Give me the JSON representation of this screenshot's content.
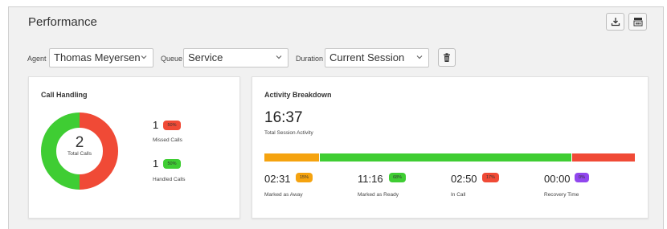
{
  "header": {
    "title": "Performance",
    "download_icon": "download-icon",
    "layout_icon": "layout-icon"
  },
  "filters": {
    "agent_label": "Agent",
    "agent_value": "Thomas Meyersen",
    "queue_label": "Queue",
    "queue_value": "Service",
    "duration_label": "Duration",
    "duration_value": "Current Session",
    "clear_icon": "trash-icon"
  },
  "call_handling": {
    "title": "Call Handling",
    "total": "2",
    "total_label": "Total Calls",
    "missed": {
      "count": "1",
      "percent": "50%",
      "label": "Missed Calls"
    },
    "handled": {
      "count": "1",
      "percent": "50%",
      "label": "Handled Calls"
    },
    "chart_data": {
      "type": "pie",
      "categories": [
        "Missed Calls",
        "Handled Calls"
      ],
      "values": [
        1,
        1
      ],
      "colors": [
        "#f04a36",
        "#3fcd33"
      ]
    }
  },
  "activity": {
    "title": "Activity Breakdown",
    "total_time": "16:37",
    "total_label": "Total Session Activity",
    "items": [
      {
        "time": "02:31",
        "percent": "15%",
        "label": "Marked as Away",
        "color": "#f5a30f",
        "share": 15
      },
      {
        "time": "11:16",
        "percent": "68%",
        "label": "Marked as Ready",
        "color": "#3fcd33",
        "share": 68
      },
      {
        "time": "02:50",
        "percent": "17%",
        "label": "In Call",
        "color": "#f04a36",
        "share": 17
      },
      {
        "time": "00:00",
        "percent": "0%",
        "label": "Recovery Time",
        "color": "#9147ee",
        "share": 0
      }
    ]
  }
}
